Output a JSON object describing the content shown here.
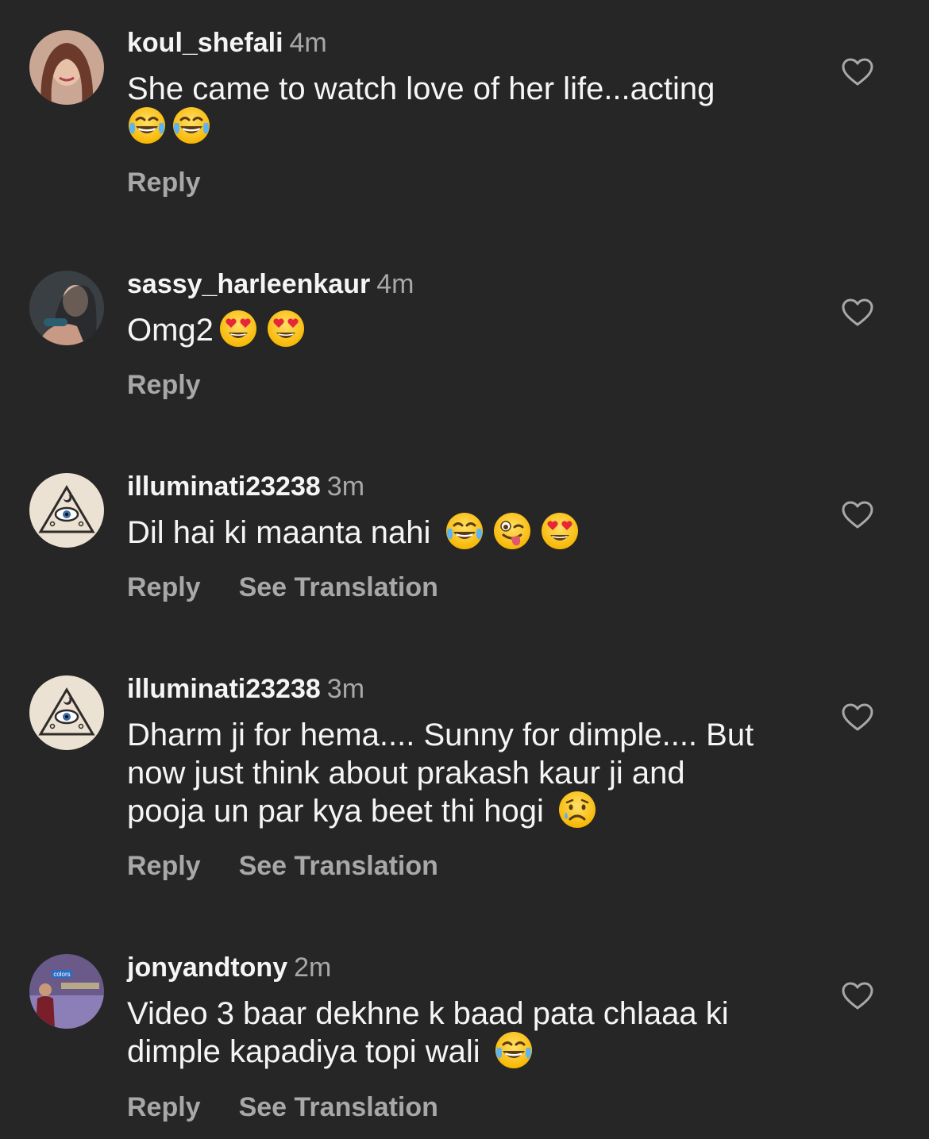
{
  "comments": [
    {
      "username": "koul_shefali",
      "time": "4m",
      "text": "She came to watch love of her life...acting",
      "emojis": [
        "joy",
        "joy"
      ],
      "reply_label": "Reply",
      "translation_label": ""
    },
    {
      "username": "sassy_harleenkaur",
      "time": "4m",
      "text": "Omg2",
      "emojis": [
        "heart-eyes",
        "heart-eyes"
      ],
      "reply_label": "Reply",
      "translation_label": ""
    },
    {
      "username": "illuminati23238",
      "time": "3m",
      "text": "Dil hai ki maanta nahi ",
      "emojis": [
        "joy",
        "winking-tongue",
        "heart-eyes"
      ],
      "reply_label": "Reply",
      "translation_label": "See Translation"
    },
    {
      "username": "illuminati23238",
      "time": "3m",
      "text": "Dharm ji for hema.... Sunny for dimple.... But now just think about prakash kaur ji and pooja un par kya beet thi hogi ",
      "emojis": [
        "crying"
      ],
      "reply_label": "Reply",
      "translation_label": "See Translation"
    },
    {
      "username": "jonyandtony",
      "time": "2m",
      "text": "Video 3 baar dekhne k baad pata chlaaa ki dimple kapadiya topi wali ",
      "emojis": [
        "joy"
      ],
      "reply_label": "Reply",
      "translation_label": "See Translation",
      "avatar_badge": "colors"
    }
  ],
  "icons": {
    "like": "heart-outline-icon"
  },
  "colors": {
    "background": "#262626",
    "primary_text": "#f5f5f5",
    "secondary_text": "#a8a8a8"
  }
}
